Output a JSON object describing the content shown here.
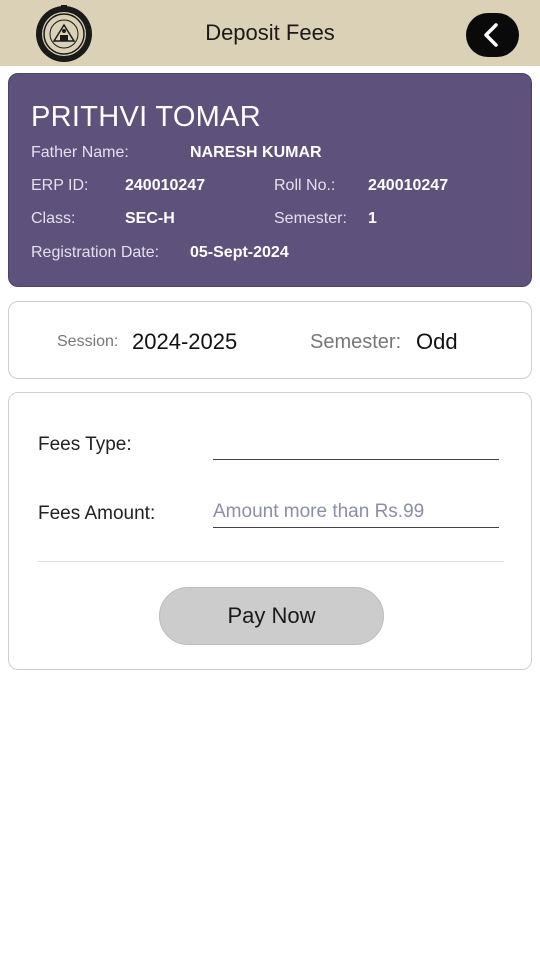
{
  "header": {
    "title": "Deposit Fees",
    "logo_icon": "university-seal-icon",
    "back_icon": "chevron-left-icon"
  },
  "student": {
    "name": "PRITHVI TOMAR",
    "father_label": "Father Name:",
    "father_value": "NARESH KUMAR",
    "erp_label": "ERP ID:",
    "erp_value": "240010247",
    "roll_label": "Roll No.:",
    "roll_value": "240010247",
    "class_label": "Class:",
    "class_value": "SEC-H",
    "semester_label": "Semester:",
    "semester_value": "1",
    "regdate_label": "Registration Date:",
    "regdate_value": "05-Sept-2024"
  },
  "session": {
    "session_label": "Session:",
    "session_value": "2024-2025",
    "semester_label": "Semester:",
    "semester_value": "Odd"
  },
  "fees": {
    "type_label": "Fees Type:",
    "type_value": "",
    "amount_label": "Fees Amount:",
    "amount_value": "",
    "amount_placeholder": "Amount more than Rs.99",
    "pay_label": "Pay Now"
  },
  "colors": {
    "header_bg": "#dbd1b6",
    "card_bg": "#5e527c",
    "button_bg": "#cccccc"
  }
}
